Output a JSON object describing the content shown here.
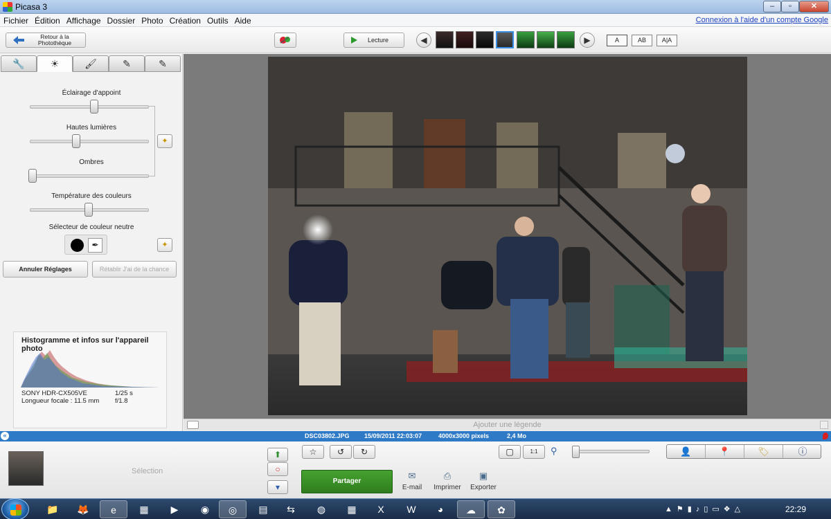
{
  "window": {
    "title": "Picasa 3"
  },
  "menu": {
    "items": [
      "Fichier",
      "Édition",
      "Affichage",
      "Dossier",
      "Photo",
      "Création",
      "Outils",
      "Aide"
    ],
    "google_link": "Connexion à l'aide d'un compte Google"
  },
  "toolbar": {
    "back_label_1": "Retour à la",
    "back_label_2": "Photothèque",
    "play_label": "Lecture",
    "view_buttons": [
      "A",
      "AB",
      "A|A"
    ]
  },
  "tuning": {
    "sliders": [
      {
        "label": "Éclairage d'appoint",
        "value": 0.55
      },
      {
        "label": "Hautes lumières",
        "value": 0.39
      },
      {
        "label": "Ombres",
        "value": 0.0
      },
      {
        "label": "Température des couleurs",
        "value": 0.5
      }
    ],
    "neutral_label": "Sélecteur de couleur neutre",
    "undo_label": "Annuler Réglages",
    "redo_label": "Rétablir J'ai de la chance"
  },
  "histogram": {
    "title": "Histogramme et infos sur l'appareil photo",
    "camera": "SONY HDR-CX505VE",
    "exposure": "1/25 s",
    "focal": "Longueur focale : 11.5 mm",
    "aperture": "f/1.8"
  },
  "caption": {
    "placeholder": "Ajouter une légende"
  },
  "info": {
    "filename": "DSC03802.JPG",
    "datetime": "15/09/2011 22:03:07",
    "dimensions": "4000x3000 pixels",
    "size": "2,4 Mo"
  },
  "tray": {
    "selection_label": "Sélection",
    "share_label": "Partager",
    "actions": [
      {
        "label": "E-mail",
        "icon": "envelope-icon"
      },
      {
        "label": "Imprimer",
        "icon": "printer-icon"
      },
      {
        "label": "Exporter",
        "icon": "export-folder-icon"
      }
    ],
    "zoom_label": "1:1",
    "zoom_value": 0.0
  },
  "taskbar": {
    "time": "22:29"
  },
  "colors": {
    "accent": "#2f7ac7",
    "share": "#3a8f27"
  }
}
